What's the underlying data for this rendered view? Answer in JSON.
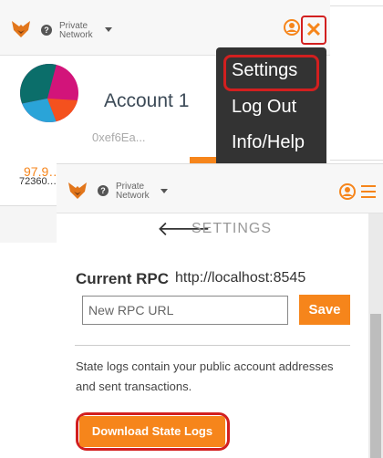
{
  "colors": {
    "accent": "#f6851b",
    "highlight": "#d21f1f",
    "menu_bg": "#333333"
  },
  "back_panel": {
    "network_line1": "Private",
    "network_line2": "Network",
    "account_name": "Account 1",
    "account_address": "0xef6Ea...",
    "balance_eth": "97.9…",
    "balance_usd": "72360.…",
    "menu": {
      "items": [
        "Settings",
        "Log Out",
        "Info/Help"
      ]
    }
  },
  "front_panel": {
    "network_line1": "Private",
    "network_line2": "Network",
    "title": "SETTINGS",
    "rpc_label": "Current RPC",
    "rpc_value": "http://localhost:8545",
    "rpc_placeholder": "New RPC URL",
    "save_label": "Save",
    "state_logs_text": "State logs contain your public account addresses and sent transactions.",
    "download_label": "Download State Logs"
  }
}
